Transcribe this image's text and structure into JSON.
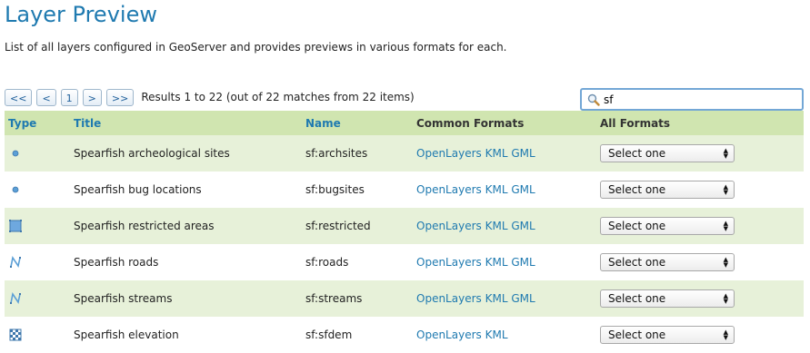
{
  "page": {
    "title": "Layer Preview",
    "description": "List of all layers configured in GeoServer and provides previews in various formats for each."
  },
  "pager": {
    "first": "<<",
    "prev": "<",
    "page": "1",
    "next": ">",
    "last": ">>",
    "results": "Results 1 to 22 (out of 22 matches from 22 items)"
  },
  "search": {
    "value": "sf",
    "icon": "magnifier-icon"
  },
  "table": {
    "headers": {
      "type": "Type",
      "title": "Title",
      "name": "Name",
      "common": "Common Formats",
      "all": "All Formats"
    },
    "rows": [
      {
        "type_icon": "point-icon",
        "title": "Spearfish archeological sites",
        "name": "sf:archsites",
        "formats": [
          "OpenLayers",
          "KML",
          "GML"
        ],
        "select": "Select one"
      },
      {
        "type_icon": "point-icon",
        "title": "Spearfish bug locations",
        "name": "sf:bugsites",
        "formats": [
          "OpenLayers",
          "KML",
          "GML"
        ],
        "select": "Select one"
      },
      {
        "type_icon": "polygon-icon",
        "title": "Spearfish restricted areas",
        "name": "sf:restricted",
        "formats": [
          "OpenLayers",
          "KML",
          "GML"
        ],
        "select": "Select one"
      },
      {
        "type_icon": "line-icon",
        "title": "Spearfish roads",
        "name": "sf:roads",
        "formats": [
          "OpenLayers",
          "KML",
          "GML"
        ],
        "select": "Select one"
      },
      {
        "type_icon": "line-icon",
        "title": "Spearfish streams",
        "name": "sf:streams",
        "formats": [
          "OpenLayers",
          "KML",
          "GML"
        ],
        "select": "Select one"
      },
      {
        "type_icon": "raster-icon",
        "title": "Spearfish elevation",
        "name": "sf:sfdem",
        "formats": [
          "OpenLayers",
          "KML"
        ],
        "select": "Select one"
      }
    ]
  },
  "colors": {
    "title_blue": "#1f7ab0",
    "header_green": "#d0e5b0",
    "row_green": "#e7f1d9"
  }
}
